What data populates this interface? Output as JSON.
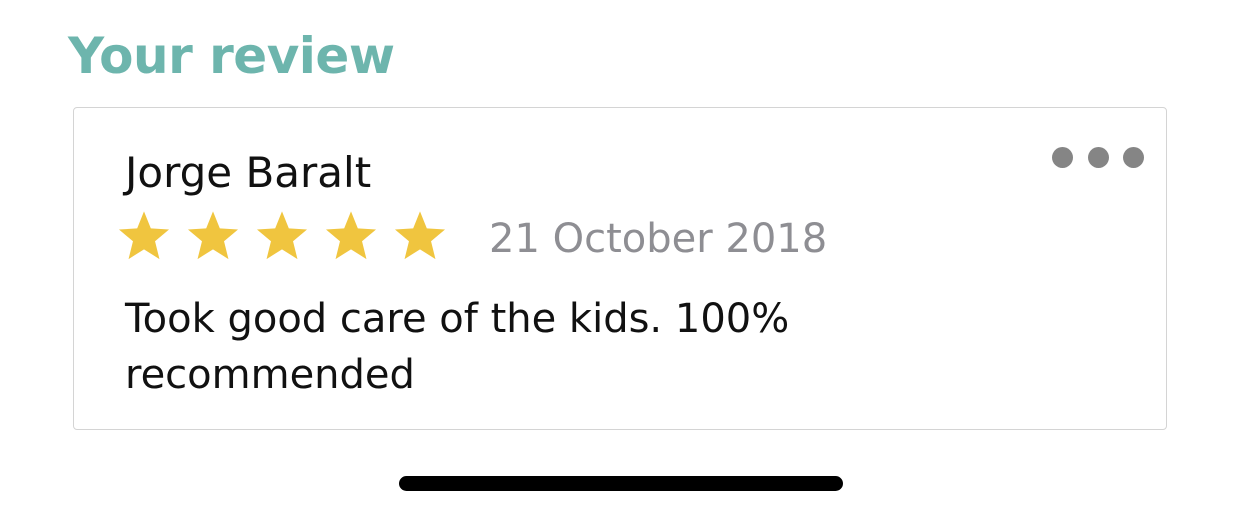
{
  "section": {
    "title": "Your review"
  },
  "review": {
    "reviewer_name": "Jorge Baralt",
    "rating": 5,
    "rating_max": 5,
    "date": "21 October 2018",
    "text": "Took good care of the kids. 100% recommended"
  },
  "icons": {
    "more": "more-options-icon",
    "star": "star-icon"
  },
  "colors": {
    "title_accent": "#6db5ad",
    "star_filled": "#f0c53f",
    "date_text": "#8e8e93",
    "more_dots": "#858585",
    "home_indicator": "#000000"
  }
}
